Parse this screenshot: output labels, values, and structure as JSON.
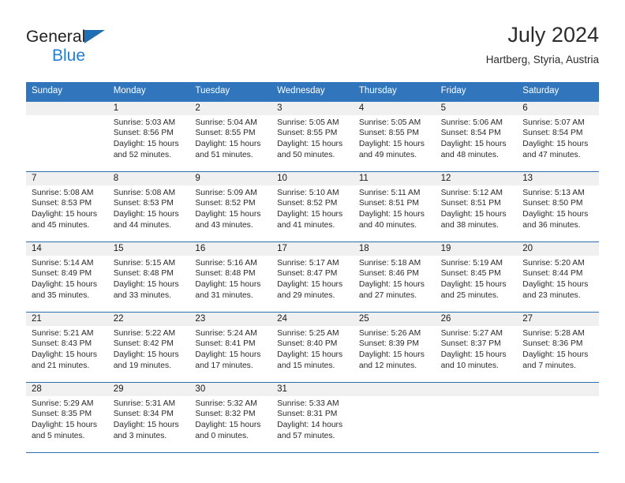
{
  "brand": {
    "name_part1": "General",
    "name_part2": "Blue",
    "flag_icon": "triangle-flag-icon",
    "accent_color": "#1f7fd4"
  },
  "header": {
    "title": "July 2024",
    "subtitle": "Hartberg, Styria, Austria"
  },
  "theme": {
    "header_blue": "#3176bc",
    "row_divider": "#2d6eb0",
    "daynum_band": "#f0f0f0"
  },
  "weekdays": [
    "Sunday",
    "Monday",
    "Tuesday",
    "Wednesday",
    "Thursday",
    "Friday",
    "Saturday"
  ],
  "weeks": [
    [
      {
        "day": "",
        "empty": true,
        "sunrise": "",
        "sunset": "",
        "daylight_1": "",
        "daylight_2": ""
      },
      {
        "day": "1",
        "sunrise": "Sunrise: 5:03 AM",
        "sunset": "Sunset: 8:56 PM",
        "daylight_1": "Daylight: 15 hours",
        "daylight_2": "and 52 minutes."
      },
      {
        "day": "2",
        "sunrise": "Sunrise: 5:04 AM",
        "sunset": "Sunset: 8:55 PM",
        "daylight_1": "Daylight: 15 hours",
        "daylight_2": "and 51 minutes."
      },
      {
        "day": "3",
        "sunrise": "Sunrise: 5:05 AM",
        "sunset": "Sunset: 8:55 PM",
        "daylight_1": "Daylight: 15 hours",
        "daylight_2": "and 50 minutes."
      },
      {
        "day": "4",
        "sunrise": "Sunrise: 5:05 AM",
        "sunset": "Sunset: 8:55 PM",
        "daylight_1": "Daylight: 15 hours",
        "daylight_2": "and 49 minutes."
      },
      {
        "day": "5",
        "sunrise": "Sunrise: 5:06 AM",
        "sunset": "Sunset: 8:54 PM",
        "daylight_1": "Daylight: 15 hours",
        "daylight_2": "and 48 minutes."
      },
      {
        "day": "6",
        "sunrise": "Sunrise: 5:07 AM",
        "sunset": "Sunset: 8:54 PM",
        "daylight_1": "Daylight: 15 hours",
        "daylight_2": "and 47 minutes."
      }
    ],
    [
      {
        "day": "7",
        "sunrise": "Sunrise: 5:08 AM",
        "sunset": "Sunset: 8:53 PM",
        "daylight_1": "Daylight: 15 hours",
        "daylight_2": "and 45 minutes."
      },
      {
        "day": "8",
        "sunrise": "Sunrise: 5:08 AM",
        "sunset": "Sunset: 8:53 PM",
        "daylight_1": "Daylight: 15 hours",
        "daylight_2": "and 44 minutes."
      },
      {
        "day": "9",
        "sunrise": "Sunrise: 5:09 AM",
        "sunset": "Sunset: 8:52 PM",
        "daylight_1": "Daylight: 15 hours",
        "daylight_2": "and 43 minutes."
      },
      {
        "day": "10",
        "sunrise": "Sunrise: 5:10 AM",
        "sunset": "Sunset: 8:52 PM",
        "daylight_1": "Daylight: 15 hours",
        "daylight_2": "and 41 minutes."
      },
      {
        "day": "11",
        "sunrise": "Sunrise: 5:11 AM",
        "sunset": "Sunset: 8:51 PM",
        "daylight_1": "Daylight: 15 hours",
        "daylight_2": "and 40 minutes."
      },
      {
        "day": "12",
        "sunrise": "Sunrise: 5:12 AM",
        "sunset": "Sunset: 8:51 PM",
        "daylight_1": "Daylight: 15 hours",
        "daylight_2": "and 38 minutes."
      },
      {
        "day": "13",
        "sunrise": "Sunrise: 5:13 AM",
        "sunset": "Sunset: 8:50 PM",
        "daylight_1": "Daylight: 15 hours",
        "daylight_2": "and 36 minutes."
      }
    ],
    [
      {
        "day": "14",
        "sunrise": "Sunrise: 5:14 AM",
        "sunset": "Sunset: 8:49 PM",
        "daylight_1": "Daylight: 15 hours",
        "daylight_2": "and 35 minutes."
      },
      {
        "day": "15",
        "sunrise": "Sunrise: 5:15 AM",
        "sunset": "Sunset: 8:48 PM",
        "daylight_1": "Daylight: 15 hours",
        "daylight_2": "and 33 minutes."
      },
      {
        "day": "16",
        "sunrise": "Sunrise: 5:16 AM",
        "sunset": "Sunset: 8:48 PM",
        "daylight_1": "Daylight: 15 hours",
        "daylight_2": "and 31 minutes."
      },
      {
        "day": "17",
        "sunrise": "Sunrise: 5:17 AM",
        "sunset": "Sunset: 8:47 PM",
        "daylight_1": "Daylight: 15 hours",
        "daylight_2": "and 29 minutes."
      },
      {
        "day": "18",
        "sunrise": "Sunrise: 5:18 AM",
        "sunset": "Sunset: 8:46 PM",
        "daylight_1": "Daylight: 15 hours",
        "daylight_2": "and 27 minutes."
      },
      {
        "day": "19",
        "sunrise": "Sunrise: 5:19 AM",
        "sunset": "Sunset: 8:45 PM",
        "daylight_1": "Daylight: 15 hours",
        "daylight_2": "and 25 minutes."
      },
      {
        "day": "20",
        "sunrise": "Sunrise: 5:20 AM",
        "sunset": "Sunset: 8:44 PM",
        "daylight_1": "Daylight: 15 hours",
        "daylight_2": "and 23 minutes."
      }
    ],
    [
      {
        "day": "21",
        "sunrise": "Sunrise: 5:21 AM",
        "sunset": "Sunset: 8:43 PM",
        "daylight_1": "Daylight: 15 hours",
        "daylight_2": "and 21 minutes."
      },
      {
        "day": "22",
        "sunrise": "Sunrise: 5:22 AM",
        "sunset": "Sunset: 8:42 PM",
        "daylight_1": "Daylight: 15 hours",
        "daylight_2": "and 19 minutes."
      },
      {
        "day": "23",
        "sunrise": "Sunrise: 5:24 AM",
        "sunset": "Sunset: 8:41 PM",
        "daylight_1": "Daylight: 15 hours",
        "daylight_2": "and 17 minutes."
      },
      {
        "day": "24",
        "sunrise": "Sunrise: 5:25 AM",
        "sunset": "Sunset: 8:40 PM",
        "daylight_1": "Daylight: 15 hours",
        "daylight_2": "and 15 minutes."
      },
      {
        "day": "25",
        "sunrise": "Sunrise: 5:26 AM",
        "sunset": "Sunset: 8:39 PM",
        "daylight_1": "Daylight: 15 hours",
        "daylight_2": "and 12 minutes."
      },
      {
        "day": "26",
        "sunrise": "Sunrise: 5:27 AM",
        "sunset": "Sunset: 8:37 PM",
        "daylight_1": "Daylight: 15 hours",
        "daylight_2": "and 10 minutes."
      },
      {
        "day": "27",
        "sunrise": "Sunrise: 5:28 AM",
        "sunset": "Sunset: 8:36 PM",
        "daylight_1": "Daylight: 15 hours",
        "daylight_2": "and 7 minutes."
      }
    ],
    [
      {
        "day": "28",
        "sunrise": "Sunrise: 5:29 AM",
        "sunset": "Sunset: 8:35 PM",
        "daylight_1": "Daylight: 15 hours",
        "daylight_2": "and 5 minutes."
      },
      {
        "day": "29",
        "sunrise": "Sunrise: 5:31 AM",
        "sunset": "Sunset: 8:34 PM",
        "daylight_1": "Daylight: 15 hours",
        "daylight_2": "and 3 minutes."
      },
      {
        "day": "30",
        "sunrise": "Sunrise: 5:32 AM",
        "sunset": "Sunset: 8:32 PM",
        "daylight_1": "Daylight: 15 hours",
        "daylight_2": "and 0 minutes."
      },
      {
        "day": "31",
        "sunrise": "Sunrise: 5:33 AM",
        "sunset": "Sunset: 8:31 PM",
        "daylight_1": "Daylight: 14 hours",
        "daylight_2": "and 57 minutes."
      },
      {
        "day": "",
        "empty": true,
        "sunrise": "",
        "sunset": "",
        "daylight_1": "",
        "daylight_2": ""
      },
      {
        "day": "",
        "empty": true,
        "sunrise": "",
        "sunset": "",
        "daylight_1": "",
        "daylight_2": ""
      },
      {
        "day": "",
        "empty": true,
        "sunrise": "",
        "sunset": "",
        "daylight_1": "",
        "daylight_2": ""
      }
    ]
  ]
}
